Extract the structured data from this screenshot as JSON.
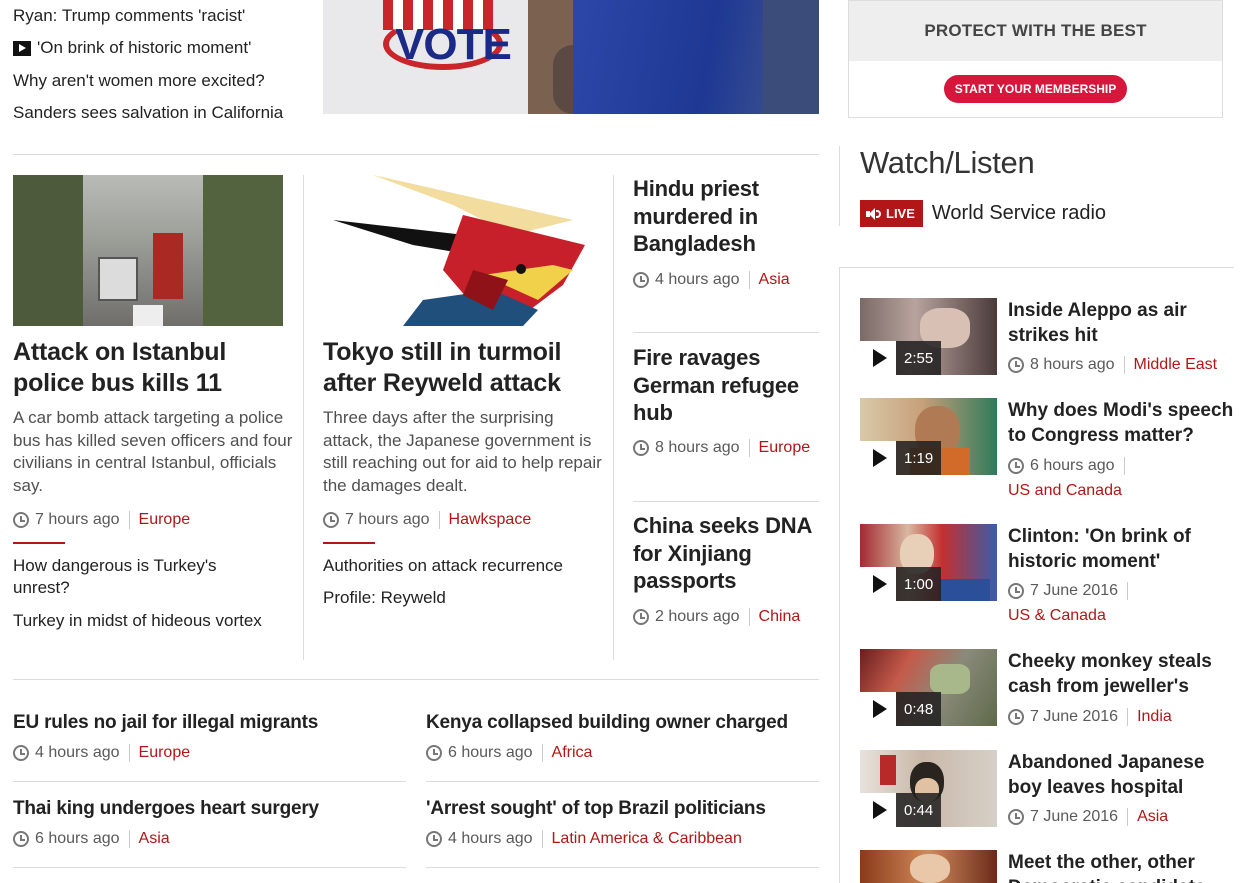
{
  "top_links": {
    "l1": "Ryan: Trump comments 'racist'",
    "l2": "'On brink of historic moment'",
    "l3": "Why aren't women more excited?",
    "l4": "Sanders sees salvation in California"
  },
  "hero_image": {
    "sign_text": "VOTE"
  },
  "ad": {
    "headline": "PROTECT WITH THE BEST",
    "cta": "START YOUR MEMBERSHIP"
  },
  "story1": {
    "title": "Attack on Istanbul police bus kills 11",
    "summary": "A car bomb attack targeting a police bus has killed seven officers and four civilians in central Istanbul, officials say.",
    "time": "7 hours ago",
    "section": "Europe",
    "related1": "How dangerous is Turkey's unrest?",
    "related2": "Turkey in midst of hideous vortex"
  },
  "story2": {
    "title": "Tokyo still in turmoil after Reyweld attack",
    "summary": "Three days after the surprising attack, the Japanese government is still reaching out for aid to help repair the damages dealt.",
    "time": "7 hours ago",
    "section": "Hawkspace",
    "related1": "Authorities on attack recurrence",
    "related2": "Profile: Reyweld"
  },
  "story3": {
    "title": "Hindu priest murdered in Bangladesh",
    "time": "4 hours ago",
    "section": "Asia"
  },
  "story4": {
    "title": "Fire ravages German refugee hub",
    "time": "8 hours ago",
    "section": "Europe"
  },
  "story5": {
    "title": "China seeks DNA for Xinjiang passports",
    "time": "2 hours ago",
    "section": "China"
  },
  "bottom": [
    {
      "title": "EU rules no jail for illegal migrants",
      "time": "4 hours ago",
      "section": "Europe"
    },
    {
      "title": "Kenya collapsed building owner charged",
      "time": "6 hours ago",
      "section": "Africa"
    },
    {
      "title": "Thai king undergoes heart surgery",
      "time": "6 hours ago",
      "section": "Asia"
    },
    {
      "title": "'Arrest sought' of top Brazil politicians",
      "time": "4 hours ago",
      "section": "Latin America & Caribbean"
    }
  ],
  "watch": {
    "heading": "Watch/Listen",
    "live_label": "LIVE",
    "live_station": "World Service radio",
    "videos": [
      {
        "title": "Inside Aleppo as air strikes hit",
        "duration": "2:55",
        "time": "8 hours ago",
        "section": "Middle East"
      },
      {
        "title": "Why does Modi's speech to Congress matter?",
        "duration": "1:19",
        "time": "6 hours ago",
        "section": "US and Canada"
      },
      {
        "title": "Clinton: 'On brink of historic moment'",
        "duration": "1:00",
        "time": "7 June 2016",
        "section": "US & Canada"
      },
      {
        "title": "Cheeky monkey steals cash from jeweller's",
        "duration": "0:48",
        "time": "7 June 2016",
        "section": "India"
      },
      {
        "title": "Abandoned Japanese boy leaves hospital",
        "duration": "0:44",
        "time": "7 June 2016",
        "section": "Asia"
      },
      {
        "title": "Meet the other, other Democratic candidate"
      }
    ]
  },
  "colors": {
    "accent": "#b31616",
    "text": "#222222",
    "muted": "#5a5a5a",
    "rule": "#dcdcdc"
  }
}
